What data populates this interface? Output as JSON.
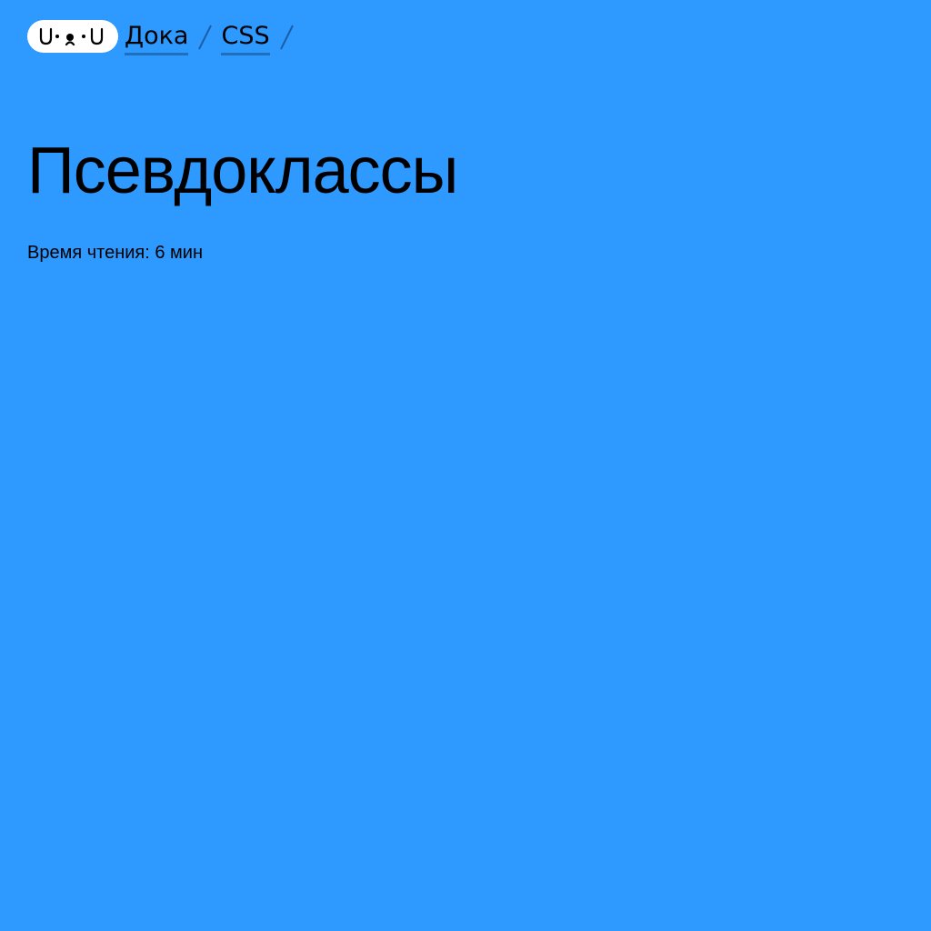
{
  "header": {
    "logo_icon": "doka-logo-icon",
    "breadcrumbs": [
      {
        "label": "Дока"
      },
      {
        "label": "CSS"
      }
    ],
    "separator_icon": "slash-separator-icon"
  },
  "article": {
    "title": "Псевдоклассы",
    "reading_time": "Время чтения: 6 мин"
  },
  "colors": {
    "background": "#2e99ff",
    "logo_background": "#ffffff",
    "link_underline": "#1f6fbf",
    "text": "#000000"
  }
}
